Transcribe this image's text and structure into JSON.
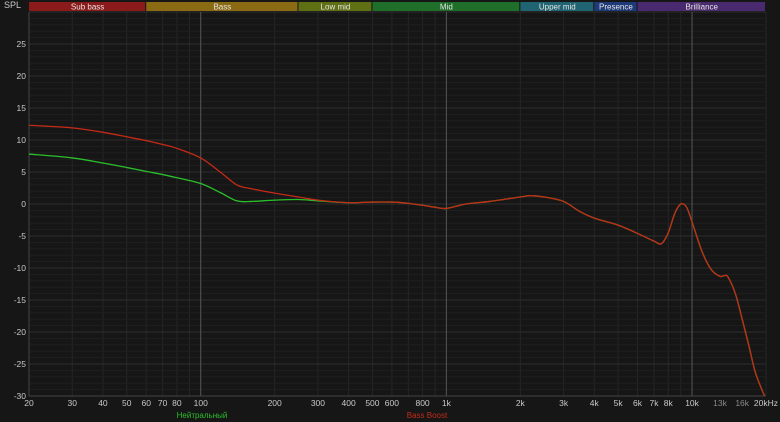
{
  "chart_data": {
    "type": "line",
    "title": "",
    "ylabel": "SPL",
    "xlabel": "",
    "x_scale": "log",
    "xlim": [
      20,
      20000
    ],
    "ylim": [
      -30,
      30
    ],
    "grid": true,
    "y_ticks": [
      -30,
      -25,
      -20,
      -15,
      -10,
      -5,
      0,
      5,
      10,
      15,
      20,
      25
    ],
    "x_ticks": [
      {
        "value": 20,
        "label": "20"
      },
      {
        "value": 30,
        "label": "30"
      },
      {
        "value": 40,
        "label": "40"
      },
      {
        "value": 50,
        "label": "50"
      },
      {
        "value": 60,
        "label": "60"
      },
      {
        "value": 70,
        "label": "70"
      },
      {
        "value": 80,
        "label": "80"
      },
      {
        "value": 100,
        "label": "100"
      },
      {
        "value": 200,
        "label": "200"
      },
      {
        "value": 300,
        "label": "300"
      },
      {
        "value": 400,
        "label": "400"
      },
      {
        "value": 500,
        "label": "500"
      },
      {
        "value": 600,
        "label": "600"
      },
      {
        "value": 800,
        "label": "800"
      },
      {
        "value": 1000,
        "label": "1k"
      },
      {
        "value": 2000,
        "label": "2k"
      },
      {
        "value": 3000,
        "label": "3k"
      },
      {
        "value": 4000,
        "label": "4k"
      },
      {
        "value": 5000,
        "label": "5k"
      },
      {
        "value": 6000,
        "label": "6k"
      },
      {
        "value": 7000,
        "label": "7k"
      },
      {
        "value": 8000,
        "label": "8k"
      },
      {
        "value": 10000,
        "label": "10k"
      },
      {
        "value": 13000,
        "label": "13k"
      },
      {
        "value": 16000,
        "label": "16k"
      },
      {
        "value": 20000,
        "label": "20kHz"
      }
    ],
    "bands": [
      {
        "name": "Sub bass",
        "from": 20,
        "to": 60,
        "color": "#8b1a1a"
      },
      {
        "name": "Bass",
        "from": 60,
        "to": 250,
        "color": "#8b6a14"
      },
      {
        "name": "Low mid",
        "from": 250,
        "to": 500,
        "color": "#5f7014"
      },
      {
        "name": "Mid",
        "from": 500,
        "to": 2000,
        "color": "#1f6e2a"
      },
      {
        "name": "Upper mid",
        "from": 2000,
        "to": 4000,
        "color": "#1f6470"
      },
      {
        "name": "Presence",
        "from": 4000,
        "to": 6000,
        "color": "#1f3a78"
      },
      {
        "name": "Brilliance",
        "from": 6000,
        "to": 20000,
        "color": "#4a2a6e"
      }
    ],
    "series": [
      {
        "name": "Нейтральный",
        "color": "#2bbf2b",
        "x": [
          20,
          30,
          40,
          50,
          60,
          70,
          80,
          100,
          120,
          140,
          160,
          200,
          250,
          300,
          400,
          500,
          600,
          700,
          800,
          900,
          1000,
          1200,
          1500,
          2000,
          2200,
          2500,
          3000,
          3500,
          4000,
          5000,
          6000,
          7000,
          7500,
          8000,
          8500,
          9000,
          9500,
          10000,
          11000,
          12000,
          13000,
          13500,
          14000,
          15000,
          16000,
          17000,
          18000,
          19000,
          20000
        ],
        "y": [
          7.8,
          7.2,
          6.4,
          5.7,
          5.1,
          4.6,
          4.1,
          3.2,
          1.8,
          0.5,
          0.4,
          0.6,
          0.7,
          0.5,
          0.2,
          0.3,
          0.3,
          0.1,
          -0.2,
          -0.5,
          -0.7,
          0.0,
          0.4,
          1.1,
          1.3,
          1.1,
          0.4,
          -1.2,
          -2.2,
          -3.3,
          -4.6,
          -5.8,
          -6.2,
          -4.5,
          -1.5,
          0.0,
          -0.5,
          -2.8,
          -7.5,
          -10.3,
          -11.3,
          -11.2,
          -11.4,
          -14.0,
          -18.0,
          -22.0,
          -26.0,
          -28.5,
          -30.5
        ]
      },
      {
        "name": "Bass Boost",
        "color": "#c42a16",
        "x": [
          20,
          30,
          40,
          50,
          60,
          70,
          80,
          100,
          120,
          140,
          160,
          200,
          250,
          300,
          400,
          500,
          600,
          700,
          800,
          900,
          1000,
          1200,
          1500,
          2000,
          2200,
          2500,
          3000,
          3500,
          4000,
          5000,
          6000,
          7000,
          7500,
          8000,
          8500,
          9000,
          9500,
          10000,
          11000,
          12000,
          13000,
          13500,
          14000,
          15000,
          16000,
          17000,
          18000,
          19000,
          20000
        ],
        "y": [
          12.3,
          11.9,
          11.2,
          10.5,
          9.9,
          9.3,
          8.7,
          7.2,
          5.0,
          3.0,
          2.4,
          1.7,
          1.1,
          0.6,
          0.2,
          0.3,
          0.3,
          0.1,
          -0.2,
          -0.5,
          -0.7,
          0.0,
          0.4,
          1.1,
          1.3,
          1.1,
          0.4,
          -1.2,
          -2.2,
          -3.3,
          -4.6,
          -5.8,
          -6.2,
          -4.5,
          -1.5,
          0.0,
          -0.5,
          -2.8,
          -7.5,
          -10.3,
          -11.3,
          -11.2,
          -11.4,
          -14.0,
          -18.0,
          -22.0,
          -26.0,
          -28.5,
          -30.5
        ]
      }
    ]
  }
}
